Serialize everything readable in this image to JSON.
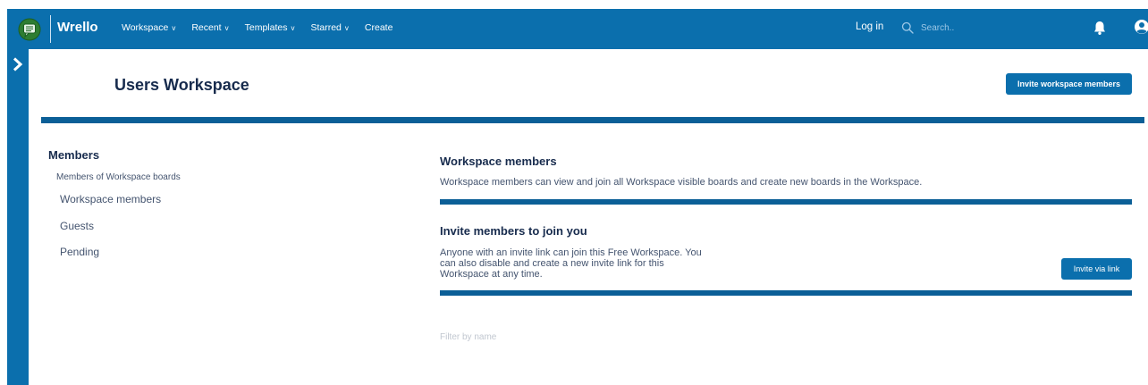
{
  "header": {
    "brand": "Wrello",
    "nav": [
      {
        "label": "Workspace",
        "chevron": "v"
      },
      {
        "label": "Recent",
        "chevron": "v"
      },
      {
        "label": "Templates",
        "chevron": "v"
      },
      {
        "label": "Starred",
        "chevron": "v"
      },
      {
        "label": "Create",
        "chevron": ""
      }
    ],
    "login": "Log in",
    "search": {
      "placeholder": "Search..",
      "value": ""
    },
    "icons": {
      "logo": "chat-logo-icon",
      "search": "search-icon",
      "bell": "bell-icon",
      "user": "user-circle-icon"
    }
  },
  "rail": {
    "icon": "chevron-right-icon"
  },
  "page": {
    "title": "Users Workspace",
    "invite_button": "Invite workspace members"
  },
  "sidebar": {
    "title": "Members",
    "subtitle": "Members of Workspace boards",
    "items": [
      "Workspace members",
      "Guests",
      "Pending"
    ]
  },
  "main": {
    "members": {
      "title": "Workspace members",
      "text": "Workspace members can view and join all Workspace visible boards and create new boards in the Workspace."
    },
    "invite": {
      "title": "Invite members to join you",
      "lines": [
        "Anyone with an invite link can join this Free Workspace. You",
        "can also disable and create a new invite link for this",
        "Workspace at any time."
      ],
      "button": "Invite via link"
    },
    "filter": {
      "placeholder": "Filter by name",
      "value": ""
    }
  },
  "colors": {
    "primary": "#0b6fad",
    "divider": "#0b5f97",
    "text": "#172b4d",
    "muted": "#44546f"
  }
}
